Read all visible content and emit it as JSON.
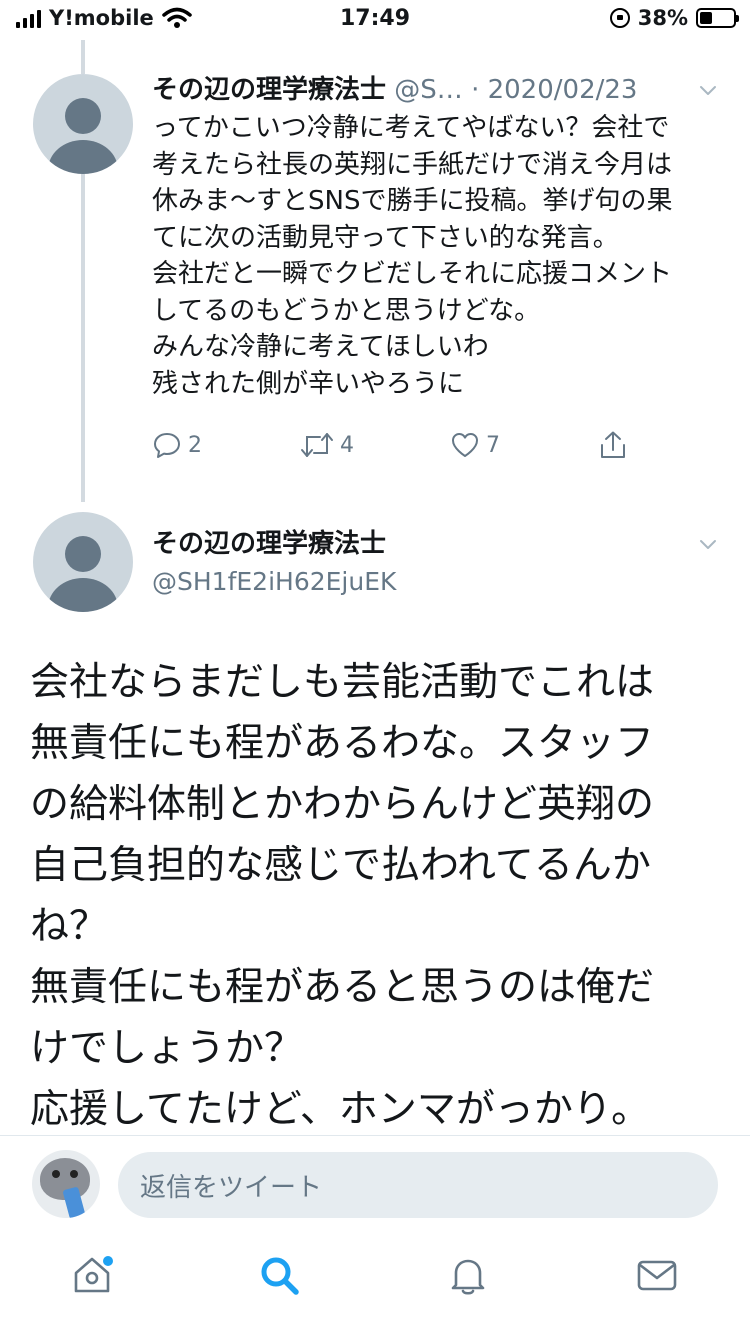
{
  "status_bar": {
    "carrier": "Y!mobile",
    "time": "17:49",
    "battery_percent": "38%",
    "battery_level": 0.38
  },
  "tweet1": {
    "name": "その辺の理学療法士",
    "handle": "@S…",
    "separator": "·",
    "date": "2020/02/23",
    "lines": [
      "ってかこいつ冷静に考えてやばない？会社で",
      "考えたら社長の英翔に手紙だけで消え今月は",
      "休みま〜すとSNSで勝手に投稿。挙げ句の果",
      "てに次の活動見守って下さい的な発言。",
      "会社だと一瞬でクビだしそれに応援コメント",
      "してるのもどうかと思うけどな。",
      "みんな冷静に考えてほしいわ",
      "残された側が辛いやろうに"
    ],
    "reply_count": "2",
    "retweet_count": "4",
    "like_count": "7"
  },
  "tweet2": {
    "name": "その辺の理学療法士",
    "handle": "@SH1fE2iH62EjuEK",
    "lines": [
      "会社ならまだしも芸能活動でこれは",
      "無責任にも程があるわな。スタッフ",
      "の給料体制とかわからんけど英翔の",
      "自己負担的な感じで払われてるんか",
      "ね？",
      "無責任にも程があると思うのは俺だ",
      "けでしょうか？",
      "応援してたけど、ホンマがっかり。"
    ]
  },
  "reply_bar": {
    "placeholder": "返信をツイート"
  },
  "tab_bar": {
    "items": [
      "home-icon",
      "search-icon",
      "notifications-icon",
      "messages-icon"
    ],
    "active": "search-icon",
    "accent_color": "#1da1f2"
  }
}
